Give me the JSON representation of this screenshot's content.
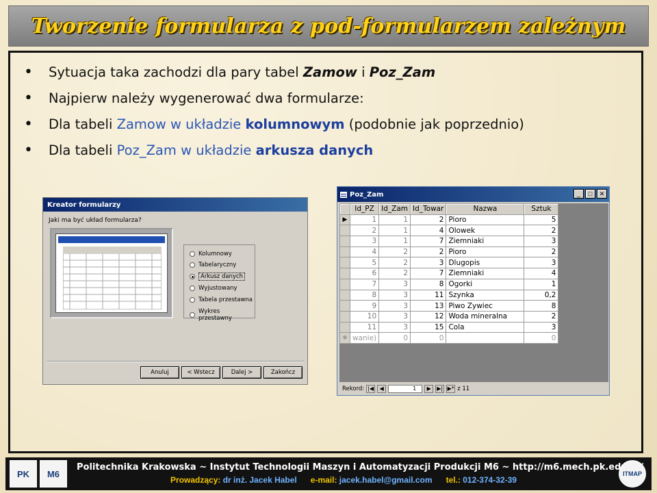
{
  "title": "Tworzenie formularza z pod-formularzem zależnym",
  "bullets": [
    {
      "pre": "Sytuacja taka zachodzi dla pary tabel ",
      "t1": "Zamow",
      "mid": " i ",
      "t2": "Poz_Zam"
    },
    {
      "text": "Najpierw należy wygenerować dwa formularze:"
    },
    {
      "pre": "Dla tabeli ",
      "tbl": "Zamow",
      "mid": " w układzie ",
      "kw": "kolumnowym",
      "post": " (podobnie jak poprzednio)"
    },
    {
      "pre": "Dla tabeli ",
      "tbl": "Poz_Zam",
      "mid": " w układzie ",
      "kw": "arkusza danych"
    }
  ],
  "wizard": {
    "title": "Kreator formularzy",
    "prompt": "Jaki ma być układ formularza?",
    "options": [
      "Kolumnowy",
      "Tabelaryczny",
      "Arkusz danych",
      "Wyjustowany",
      "Tabela przestawna",
      "Wykres przestawny"
    ],
    "selected": "Arkusz danych",
    "buttons": {
      "cancel": "Anuluj",
      "back": "< Wstecz",
      "next": "Dalej >",
      "finish": "Zakończ"
    }
  },
  "table_window": {
    "title": "Poz_Zam",
    "controls": [
      "_",
      "□",
      "✕"
    ],
    "columns": [
      "Id_PZ",
      "Id_Zam",
      "Id_Towar",
      "Nazwa",
      "Sztuk"
    ],
    "rows": [
      [
        "1",
        "1",
        "2",
        "Pioro",
        "5"
      ],
      [
        "2",
        "1",
        "4",
        "Olowek",
        "2"
      ],
      [
        "3",
        "1",
        "7",
        "Ziemniaki",
        "3"
      ],
      [
        "4",
        "2",
        "2",
        "Pioro",
        "2"
      ],
      [
        "5",
        "2",
        "3",
        "Dlugopis",
        "3"
      ],
      [
        "6",
        "2",
        "7",
        "Ziemniaki",
        "4"
      ],
      [
        "7",
        "3",
        "8",
        "Ogorki",
        "1"
      ],
      [
        "8",
        "3",
        "11",
        "Szynka",
        "0,2"
      ],
      [
        "9",
        "3",
        "13",
        "Piwo Zywiec",
        "8"
      ],
      [
        "10",
        "3",
        "12",
        "Woda mineralna",
        "2"
      ],
      [
        "11",
        "3",
        "15",
        "Cola",
        "3"
      ]
    ],
    "new_row": [
      "wanie)",
      "0",
      "0",
      "",
      "0"
    ],
    "record_label": "Rekord:",
    "current_record": "1",
    "of_label": "z 11"
  },
  "footer": {
    "line1": "Politechnika Krakowska   ~   Instytut Technologii Maszyn i Automatyzacji Produkcji M6   ~   http://m6.mech.pk.edu.pl/",
    "lead_label": "Prowadzący: ",
    "lead_value": "dr inż. Jacek Habel",
    "email_label": "e-mail: ",
    "email_value": "jacek.habel@gmail.com",
    "tel_label": "tel.: ",
    "tel_value": "012-374-32-39",
    "logo_left1": "PK",
    "logo_left2": "M6",
    "logo_right": "ITMAP"
  }
}
